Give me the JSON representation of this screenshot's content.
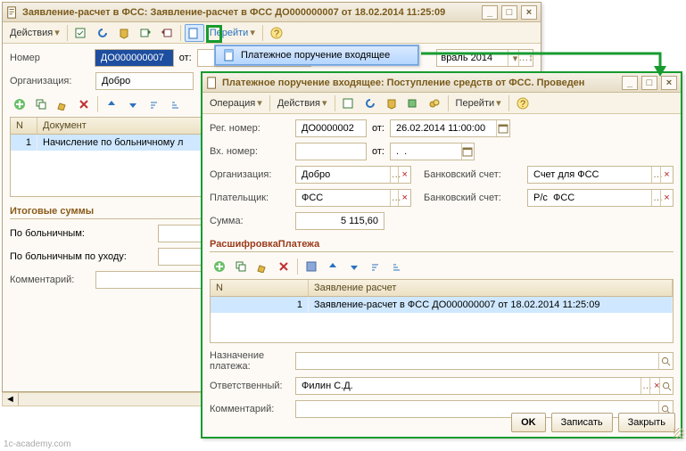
{
  "win1": {
    "title": "Заявление-расчет в ФСС: Заявление-расчет в ФСС ДО000000007 от 18.02.2014 11:25:09",
    "actions": "Действия",
    "goto": "Перейти",
    "number_label": "Номер",
    "number_value": "ДО000000007",
    "from_label": "от:",
    "period_value": "враль 2014",
    "org_label": "Организация:",
    "org_value": "Добро",
    "grid": {
      "col_n": "N",
      "col_doc": "Документ",
      "r1_n": "1",
      "r1_doc": "Начисление по больничному л"
    },
    "totals_head": "Итоговые суммы",
    "by_sick_label": "По больничным:",
    "by_sick_care_label": "По больничным по уходу:",
    "comment_label": "Комментарий:"
  },
  "menu": {
    "item": "Платежное поручение входящее"
  },
  "win2": {
    "title": "Платежное поручение входящее: Поступление средств от ФСС. Проведен",
    "operation": "Операция",
    "actions": "Действия",
    "goto": "Перейти",
    "reg_no_label": "Рег. номер:",
    "reg_no_value": "ДО0000002",
    "from_label": "от:",
    "date_value": "26.02.2014 11:00:00",
    "in_no_label": "Вх. номер:",
    "in_no_value": "",
    "in_from_label": "от:",
    "in_date_value": ".  .",
    "org_label": "Организация:",
    "org_value": "Добро",
    "bank1_label": "Банковский счет:",
    "bank1_value": "Счет для ФСС",
    "payer_label": "Плательщик:",
    "payer_value": "ФСС",
    "bank2_label": "Банковский счет:",
    "bank2_value": "Р/с  ФСС",
    "sum_label": "Сумма:",
    "sum_value": "5 115,60",
    "decr_head": "РасшифровкаПлатежа",
    "grid": {
      "col_n": "N",
      "col_claim": "Заявление расчет",
      "r1_n": "1",
      "r1_claim": "Заявление-расчет в ФСС ДО000000007 от 18.02.2014 11:25:09"
    },
    "purpose_label": "Назначение платежа:",
    "resp_label": "Ответственный:",
    "resp_value": "Филин С.Д.",
    "comment_label": "Комментарий:",
    "btn_ok": "OK",
    "btn_save": "Записать",
    "btn_close": "Закрыть"
  },
  "watermark": "1c-academy.com"
}
